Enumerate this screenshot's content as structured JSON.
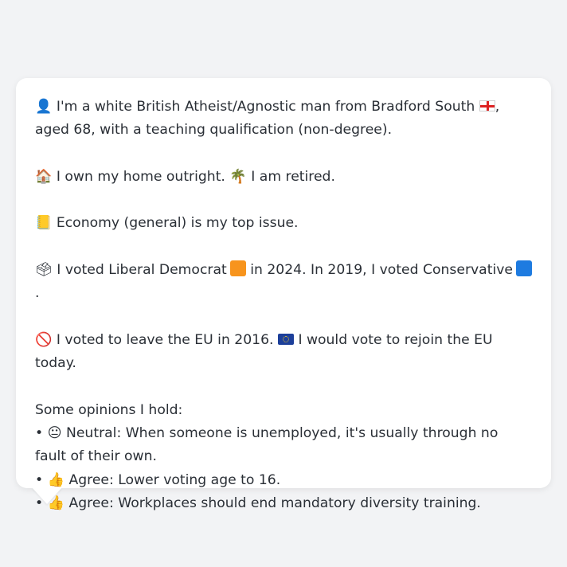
{
  "profile": {
    "line1_icon": "person-silhouette-icon",
    "line1_text_a": "I'm a white British Atheist/Agnostic man from Bradford South",
    "line1_flag": "england-flag-icon",
    "line1_text_b": ", aged 68, with a teaching qualification (non-degree).",
    "home_icon": "house-icon",
    "home_text": "I own my home outright.",
    "retired_icon": "palm-tree-icon",
    "retired_text": "I am retired.",
    "issue_icon": "ledger-icon",
    "issue_text": "Economy (general) is my top issue.",
    "vote_icon": "ballot-box-icon",
    "vote_text_a": "I voted Liberal Democrat",
    "vote_text_b": "in 2024. In 2019, I voted Conservative",
    "vote_text_c": ".",
    "eu_icon": "no-entry-icon",
    "eu_text_a": "I voted to leave the EU in 2016.",
    "eu_flag": "eu-flag-icon",
    "eu_text_b": "I would vote to rejoin the EU today.",
    "opinions_heading": "Some opinions I hold:",
    "opinions": [
      {
        "bullet": "•",
        "icon": "neutral-face-icon",
        "glyph": "😐",
        "text": "Neutral: When someone is unemployed, it's usually through no fault of their own."
      },
      {
        "bullet": "•",
        "icon": "thumbs-up-icon",
        "glyph": "👍",
        "text": "Agree: Lower voting age to 16."
      },
      {
        "bullet": "•",
        "icon": "thumbs-up-icon",
        "glyph": "👍",
        "text": "Agree: Workplaces should end mandatory diversity training."
      }
    ]
  },
  "colors": {
    "background": "#f2f3f5",
    "bubble": "#ffffff",
    "text": "#2a2f36",
    "libdem": "#f7941d",
    "conservative": "#1e7be0"
  },
  "glyphs": {
    "person": "👤",
    "house": "🏠",
    "palm": "🌴",
    "ledger": "📒",
    "ballot": "🗳",
    "noentry": "🚫"
  }
}
